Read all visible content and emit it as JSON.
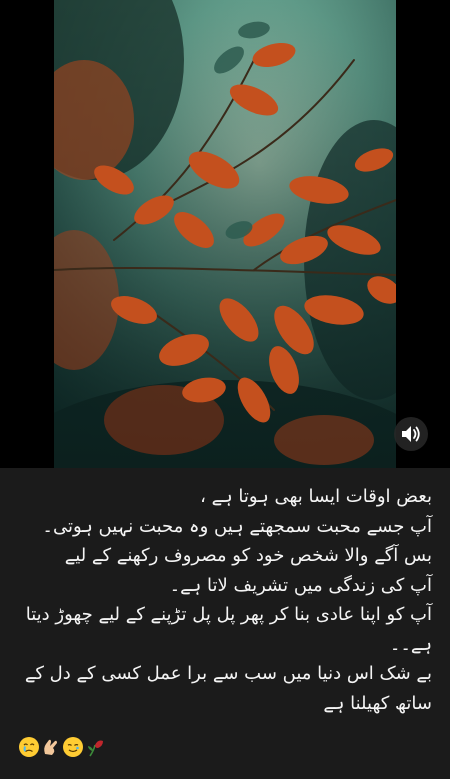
{
  "post": {
    "caption_lines": [
      "بعض اوقات ایسا بھی ہوتا ہے ،",
      "آپ جسے محبت سمجھتے ہیں وہ محبت نہیں ہوتی۔",
      "بس آگے والا شخص خود کو مصروف رکھنے کے لیے",
      "آپ کی زندگی میں تشریف لاتا ہے۔",
      "آپ کو اپنا عادی بنا کر پھر پل پل تڑپنے کے لیے چھوڑ دیتا",
      "ہے۔۔",
      "بے شک اس دنیا میں سب سے برا عمل کسی کے دل کے",
      "ساتھ کھیلنا ہے"
    ],
    "emojis": [
      "crying-face-emoji",
      "pinching-hand-emoji",
      "smiling-face-with-tear-emoji",
      "wilted-rose-emoji"
    ]
  },
  "video": {
    "sound_icon": "speaker-icon"
  },
  "colors": {
    "background": "#1b1b1b",
    "leaf_orange": "#c4501e",
    "sky_teal": "#5f9a88"
  }
}
